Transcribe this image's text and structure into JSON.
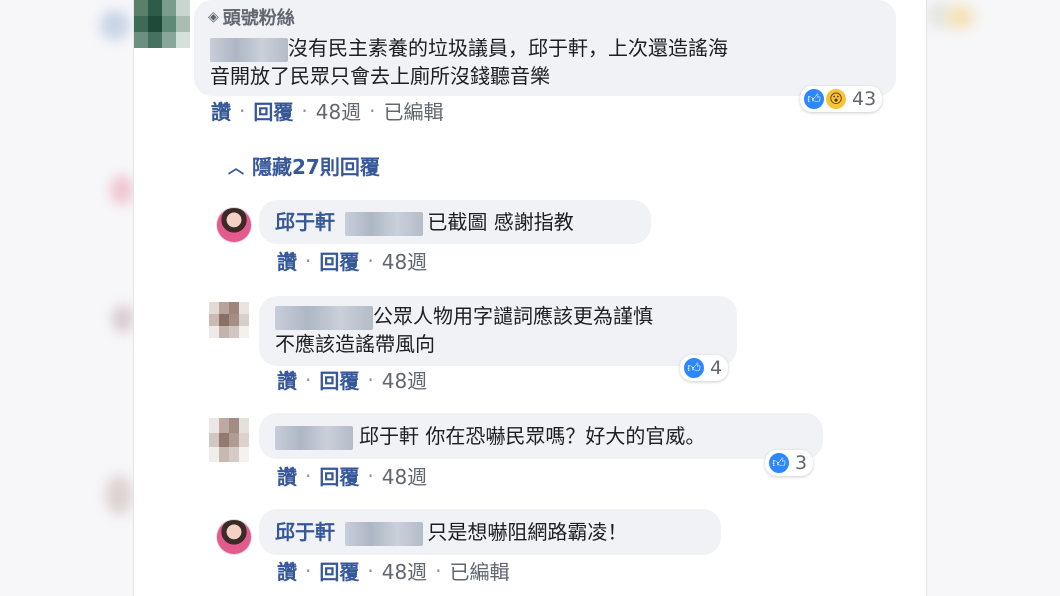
{
  "comment1": {
    "badge_label": "頭號粉絲",
    "text_line1": "沒有民主素養的垃圾議員，邱于軒，上次還造謠海",
    "text_line2": "音開放了民眾只會去上廁所沒錢聽音樂",
    "actions": {
      "like": "讚",
      "reply": "回覆",
      "time": "48週",
      "edited": "已編輯"
    },
    "reaction_count": "43"
  },
  "hide_replies": {
    "label": "隱藏27則回覆"
  },
  "reply1": {
    "author": "邱于軒",
    "text": "已截圖 感謝指教",
    "actions": {
      "like": "讚",
      "reply": "回覆",
      "time": "48週"
    }
  },
  "reply2": {
    "text_line1": "公眾人物用字譴詞應該更為謹慎",
    "text_line2": "不應該造謠帶風向",
    "actions": {
      "like": "讚",
      "reply": "回覆",
      "time": "48週"
    },
    "reaction_count": "4"
  },
  "reply3": {
    "text": "邱于軒 你在恐嚇民眾嗎？好大的官威。",
    "actions": {
      "like": "讚",
      "reply": "回覆",
      "time": "48週"
    },
    "reaction_count": "3"
  },
  "reply4": {
    "author": "邱于軒",
    "text": "只是想嚇阻網路霸凌！",
    "actions": {
      "like": "讚",
      "reply": "回覆",
      "time": "48週",
      "edited": "已編輯"
    }
  },
  "colors": {
    "link": "#365899",
    "bubble": "#f0f2f5",
    "like_blue": "#2d88ff",
    "wow_yellow": "#f7c23e"
  },
  "icons": [
    "fan-badge-icon",
    "chevron-up-icon",
    "like-reaction-icon",
    "wow-reaction-icon"
  ]
}
